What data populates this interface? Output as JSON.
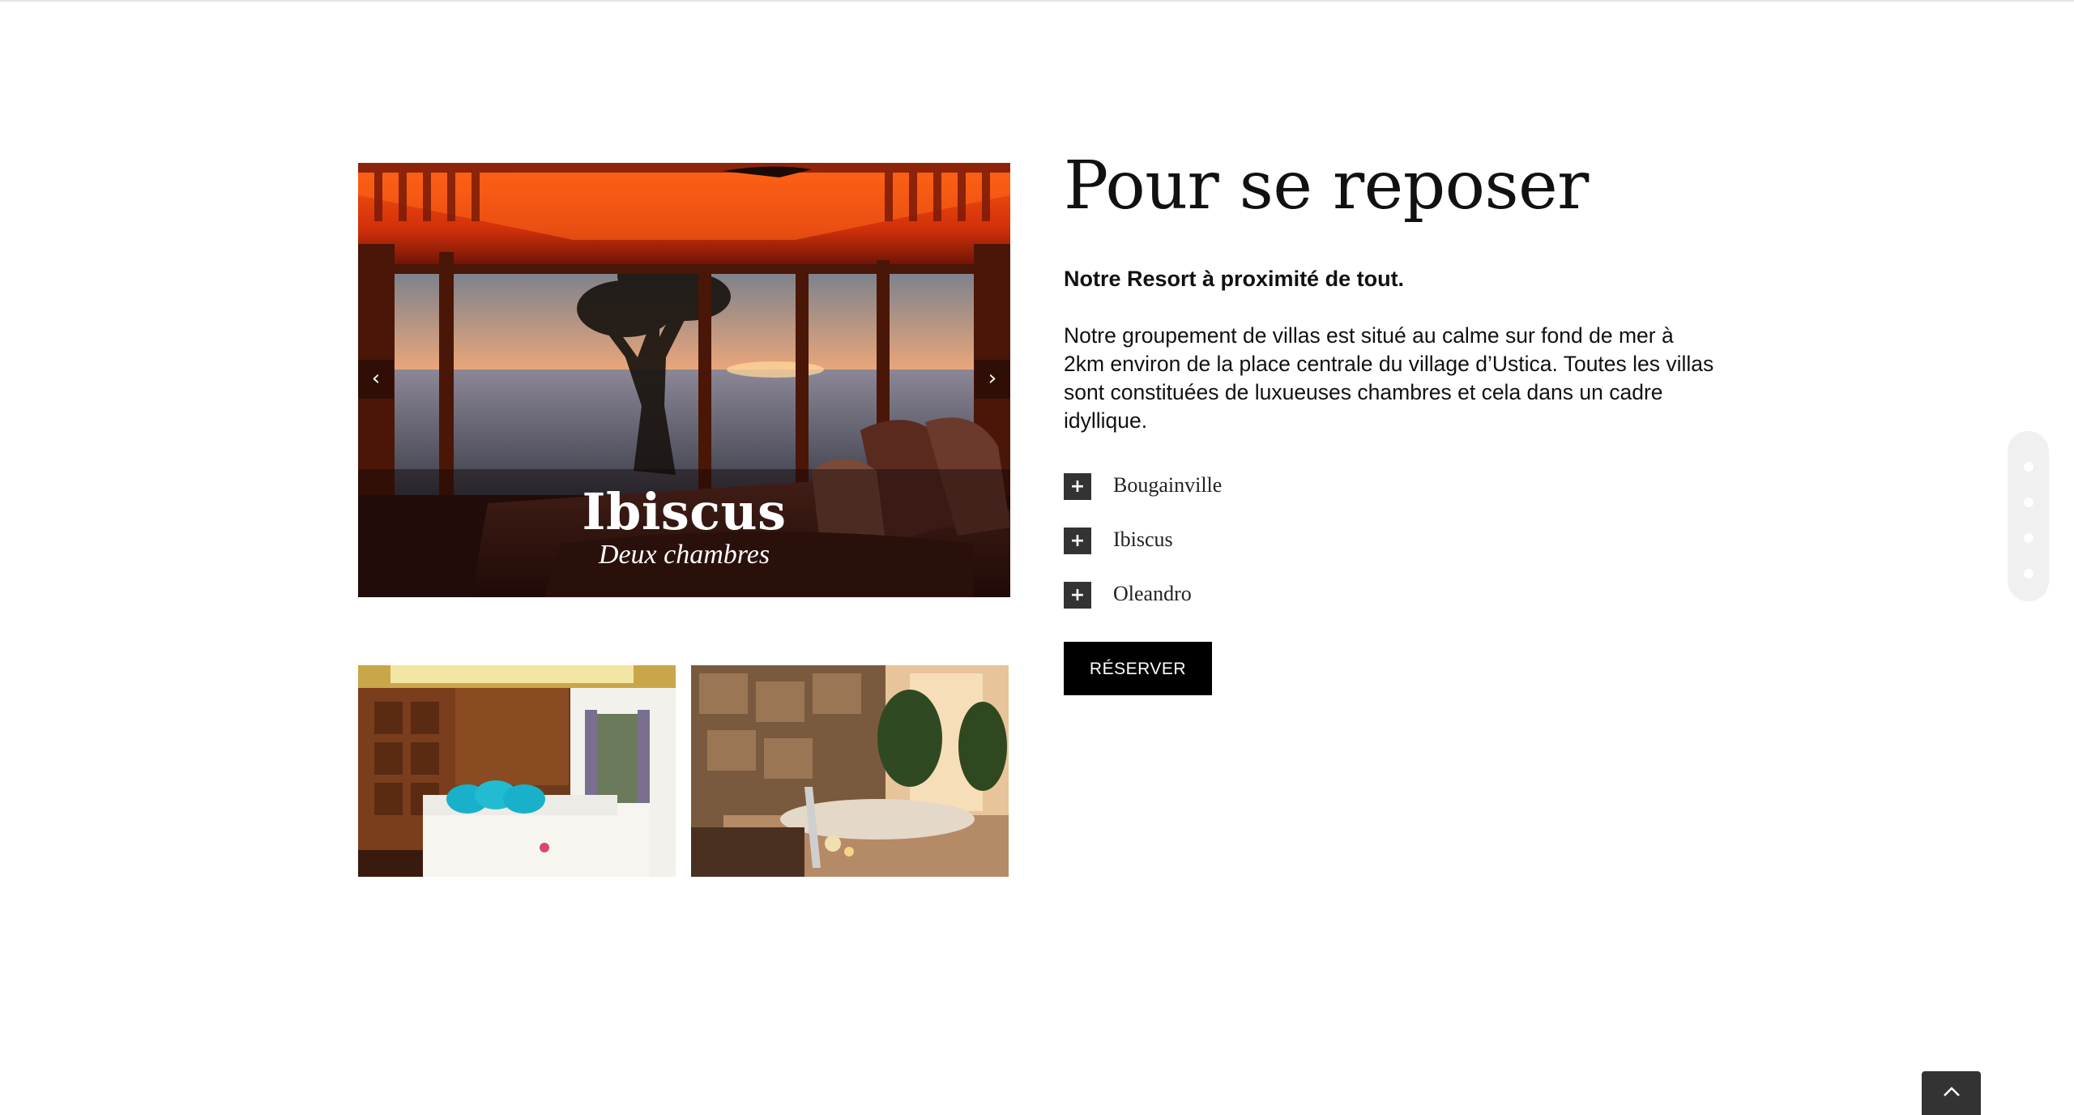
{
  "slider": {
    "title": "Ibiscus",
    "subtitle": "Deux chambres",
    "prev_icon": "chevron-left-icon",
    "next_icon": "chevron-right-icon"
  },
  "thumbnails": [
    {
      "name": "bedroom-thumbnail"
    },
    {
      "name": "spa-thumbnail"
    }
  ],
  "content": {
    "title": "Pour se reposer",
    "subtitle": "Notre Resort à proximité de tout.",
    "body": "Notre groupement de villas est situé au calme sur fond de mer à 2km environ de la place centrale du village d’Ustica. Toutes les villas sont constituées de luxueuses chambres et cela dans un cadre idyllique."
  },
  "accordion": {
    "items": [
      {
        "label": "Bougainville"
      },
      {
        "label": "Ibiscus"
      },
      {
        "label": "Oleandro"
      }
    ]
  },
  "cta": {
    "label": "RÉSERVER"
  },
  "side_nav": {
    "dots": 4
  },
  "to_top": {
    "icon": "chevron-up-icon"
  },
  "colors": {
    "button_bg": "#000000",
    "accordion_toggle_bg": "#333333",
    "side_nav_bg": "#f0f0f0"
  }
}
